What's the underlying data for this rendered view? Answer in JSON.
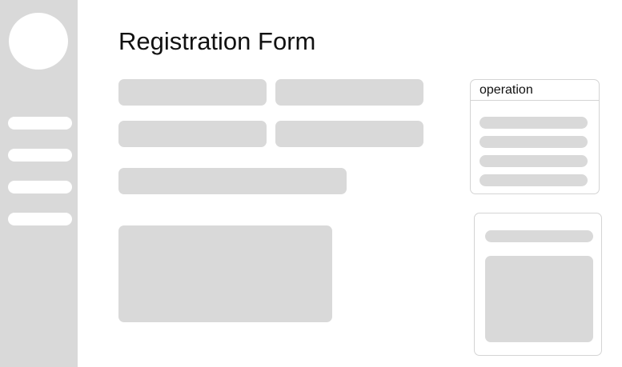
{
  "form": {
    "title": "Registration Form"
  },
  "operation_panel": {
    "header": "operation"
  }
}
